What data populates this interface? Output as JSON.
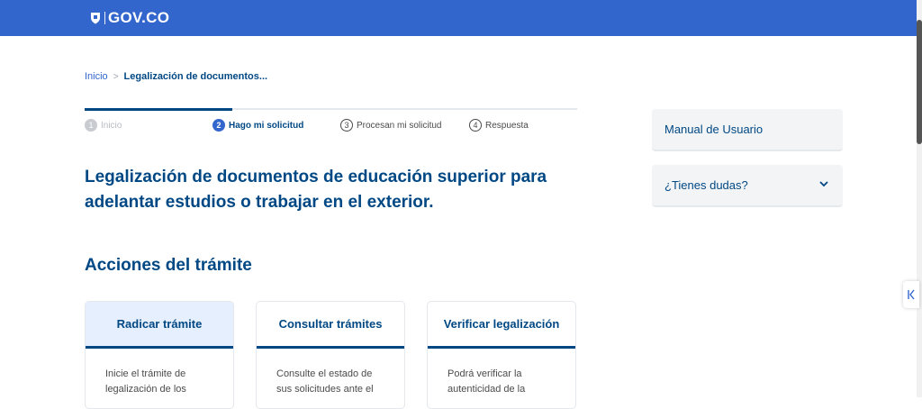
{
  "header": {
    "logo_text": "GOV.CO"
  },
  "breadcrumb": {
    "home": "Inicio",
    "separator": ">",
    "current": "Legalización de documentos..."
  },
  "steps": [
    {
      "number": "1",
      "label": "Inicio",
      "state": "done"
    },
    {
      "number": "2",
      "label": "Hago mi solicitud",
      "state": "active"
    },
    {
      "number": "3",
      "label": "Procesan mi solicitud",
      "state": "todo"
    },
    {
      "number": "4",
      "label": "Respuesta",
      "state": "todo"
    }
  ],
  "page": {
    "title": "Legalización de documentos de educación superior para adelantar estudios o trabajar en el exterior.",
    "section_title": "Acciones del trámite"
  },
  "cards": [
    {
      "title": "Radicar trámite",
      "body": "Inicie el trámite de legalización de los"
    },
    {
      "title": "Consultar trámites",
      "body": "Consulte el estado de sus solicitudes ante el"
    },
    {
      "title": "Verificar legalización",
      "body": "Podrá verificar la autenticidad de la"
    }
  ],
  "sidebar": {
    "manual": "Manual de Usuario",
    "faq": "¿Tienes dudas?"
  },
  "colors": {
    "header_bg": "#3366cc",
    "primary_text": "#004884",
    "card_selected_bg": "#e6effd",
    "side_box_bg": "#f2f4f6"
  }
}
